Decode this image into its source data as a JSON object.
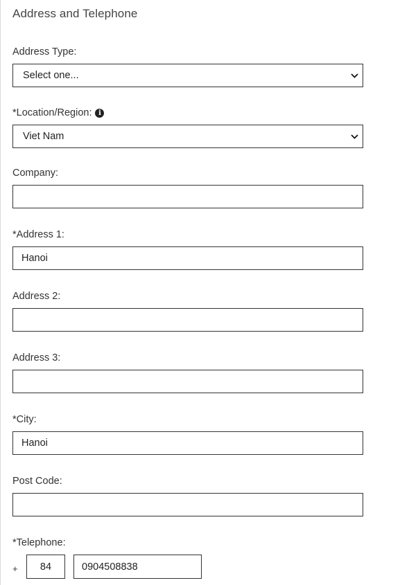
{
  "section": {
    "title": "Address and Telephone"
  },
  "address_type": {
    "label": "Address Type:",
    "selected": "Select one..."
  },
  "location": {
    "label": "*Location/Region:",
    "info_icon": "info-icon",
    "selected": "Viet Nam"
  },
  "company": {
    "label": "Company:",
    "value": ""
  },
  "address1": {
    "label": "*Address 1:",
    "value": "Hanoi"
  },
  "address2": {
    "label": "Address 2:",
    "value": ""
  },
  "address3": {
    "label": "Address 3:",
    "value": ""
  },
  "city": {
    "label": "*City:",
    "value": "Hanoi"
  },
  "post_code": {
    "label": "Post Code:",
    "value": ""
  },
  "telephone": {
    "label": "*Telephone:",
    "plus": "+",
    "country_code": "84",
    "number": "0904508838"
  }
}
